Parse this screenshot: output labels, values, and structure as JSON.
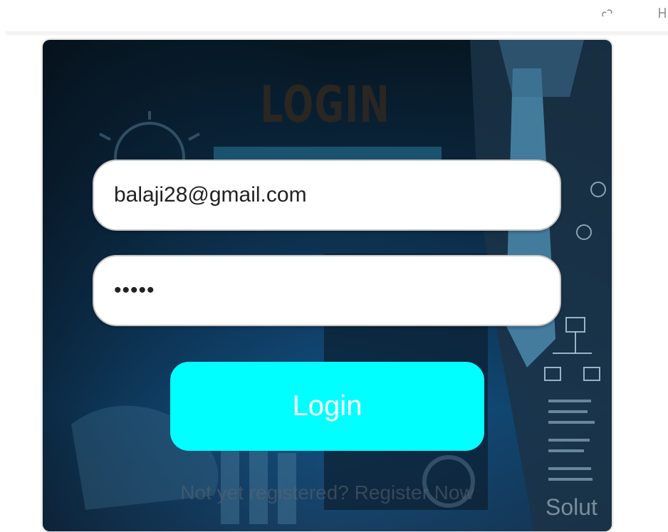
{
  "toolbar": {
    "icons": [
      "link-icon",
      "panel-icon"
    ]
  },
  "form": {
    "title": "LOGIN",
    "email_value": "balaji28@gmail.com",
    "password_value": "•••••",
    "login_label": "Login",
    "register_text": "Not yet registered? Register Now",
    "background_text": "Solut"
  },
  "colors": {
    "button": "#00ffff",
    "title": "#2a2622"
  }
}
